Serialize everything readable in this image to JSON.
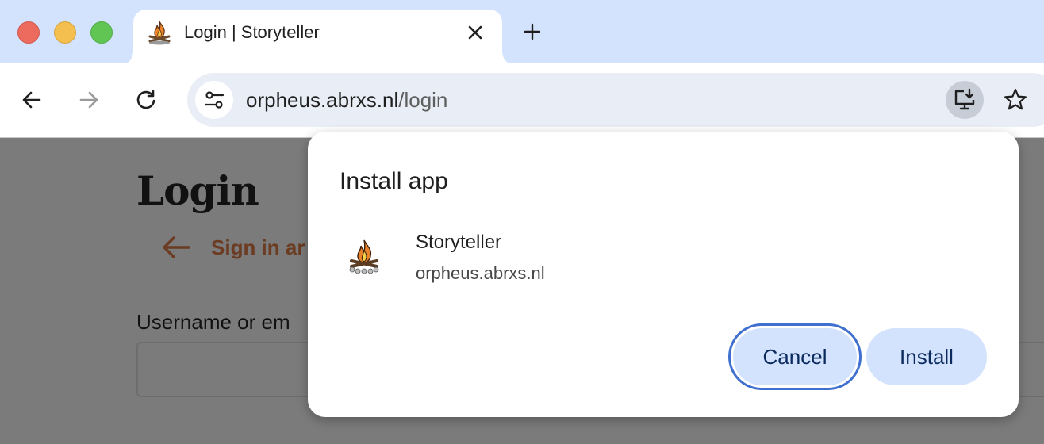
{
  "browser": {
    "tab": {
      "title": "Login | Storyteller"
    },
    "omnibox": {
      "host": "orpheus.abrxs.nl",
      "path": "/login"
    },
    "icons": [
      "close-window",
      "minimize-window",
      "maximize-window",
      "tab-favicon",
      "tab-close",
      "new-tab",
      "back",
      "forward",
      "reload",
      "site-info",
      "install-app",
      "bookmark-star"
    ]
  },
  "page": {
    "title": "Login",
    "back_link": "Sign in ar",
    "username_label": "Username or em"
  },
  "dialog": {
    "title": "Install app",
    "app_name": "Storyteller",
    "app_origin": "orpheus.abrxs.nl",
    "cancel_label": "Cancel",
    "install_label": "Install"
  },
  "colors": {
    "tabstrip_bg": "#d3e3fd",
    "button_bg": "#d3e3fd",
    "focus_ring": "#3f6fcf",
    "page_dimmed": "#7b7b7b",
    "link_color": "#6b3b22"
  }
}
